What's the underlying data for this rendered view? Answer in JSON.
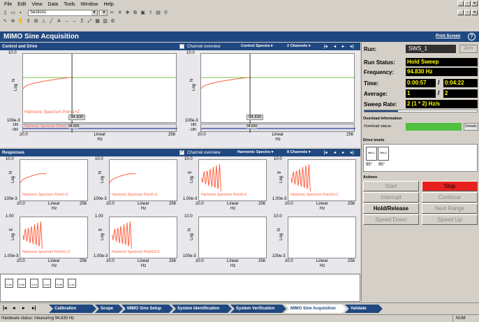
{
  "menu": {
    "items": [
      "File",
      "Edit",
      "View",
      "Data",
      "Tools",
      "Window",
      "Help"
    ]
  },
  "toolbar": {
    "section_select": "Section1"
  },
  "app": {
    "title": "MIMO Sine Acquisition",
    "print_screen": "Print Screen",
    "help": "?"
  },
  "control_panel": {
    "title": "Control and Drive",
    "channel_overview": "Channel overview",
    "control_spectra": "Control Spectra",
    "channels": "2 Channels"
  },
  "responses_panel": {
    "title": "Responses",
    "channel_overview": "Channel overview",
    "harmonic_spectra": "Harmonic Spectra",
    "channels": "8 Channels"
  },
  "plots": {
    "top": [
      {
        "ymax": "10.0",
        "ymin": "100e-3",
        "ylab": "Log",
        "yunit": "N",
        "legend": "Harmonic Spectrum Point1+Z",
        "marker": "94.830",
        "xmin": "20.0",
        "xmax": "256",
        "xlab": "Linear",
        "xunit": "Hz",
        "sub_ymax": "180",
        "sub_ymin": "-180",
        "sub_unit": "°",
        "sub_legend": "Harmonic Spectrum Point1+Z",
        "sub_marker": "94.830"
      },
      {
        "ymax": "10.0",
        "ymin": "100e-3",
        "ylab": "Log",
        "yunit": "N",
        "legend": "",
        "marker": "94.830",
        "xmin": "20.0",
        "xmax": "256",
        "xlab": "Linear",
        "xunit": "Hz",
        "sub_ymax": "180",
        "sub_ymin": "-180",
        "sub_unit": "°",
        "sub_legend": "",
        "sub_marker": "94.830"
      }
    ],
    "responses": [
      {
        "ymax": "10.0",
        "ymin": "100e-3",
        "ylab": "Log",
        "yunit": "N",
        "legend": "Harmonic Spectrum Point1+Z",
        "xmin": "20.0",
        "xmax": "256",
        "xlab": "Linear",
        "xunit": "Hz"
      },
      {
        "ymax": "10.0",
        "ymin": "100e-3",
        "ylab": "Log",
        "yunit": "N",
        "legend": "Harmonic Spectrum Point2+Z",
        "xmin": "20.0",
        "xmax": "256",
        "xlab": "Linear",
        "xunit": "Hz"
      },
      {
        "ymax": "10.0",
        "ymin": "1.00e-3",
        "ylab": "Log",
        "yunit": "g",
        "legend": "Harmonic Spectrum Point3+Z",
        "xmin": "20.0",
        "xmax": "256",
        "xlab": "Linear",
        "xunit": "Hz"
      },
      {
        "ymax": "10.0",
        "ymin": "1.00e-3",
        "ylab": "Log",
        "yunit": "g",
        "legend": "Harmonic Spectrum Point10+Z",
        "xmin": "20.0",
        "xmax": "256",
        "xlab": "Linear",
        "xunit": "Hz"
      },
      {
        "ymax": "1.00",
        "ymin": "1.00e-3",
        "ylab": "Log",
        "yunit": "g",
        "legend": "Harmonic Spectrum Point11+Z",
        "xmin": "20.0",
        "xmax": "256",
        "xlab": "Linear",
        "xunit": "Hz"
      },
      {
        "ymax": "1.00",
        "ymin": "1.00e-3",
        "ylab": "Log",
        "yunit": "g",
        "legend": "Harmonic Spectrum Point12+Z",
        "xmin": "20.0",
        "xmax": "256",
        "xlab": "Linear",
        "xunit": "Hz"
      },
      {
        "ymax": "10.0",
        "ymin": "100e-3",
        "ylab": "Log",
        "yunit": "N",
        "legend": "",
        "xmin": "20.0",
        "xmax": "256",
        "xlab": "Linear",
        "xunit": "Hz"
      },
      {
        "ymax": "10.0",
        "ymin": "100e-3",
        "ylab": "Log",
        "yunit": "N",
        "legend": "",
        "xmin": "20.0",
        "xmax": "256",
        "xlab": "Linear",
        "xunit": "Hz"
      }
    ]
  },
  "chart_data": {
    "type": "line",
    "x_range": [
      20,
      256
    ],
    "cursor_x": 94.83,
    "color": "#ff6040",
    "reference_color": "#70c040"
  },
  "channels_strip": [
    "2.00",
    "2.00",
    "0.10",
    "0.10",
    "0.05",
    "0.10"
  ],
  "run": {
    "label": "Run:",
    "name": "SWS_1",
    "arm": "Arm",
    "status_label": "Run Status:",
    "status": "Hold Sweep",
    "freq_label": "Frequency:",
    "freq": "94.830 Hz",
    "time_label": "Time:",
    "time_elapsed": "0:00:57",
    "time_total": "0:04:22",
    "avg_label": "Average:",
    "avg": "1",
    "avg_total": "2",
    "rate_label": "Sweep Rate:",
    "rate": "2 (1 * 2) Hz/s",
    "progress": 0.3
  },
  "overload": {
    "title": "Overload Information",
    "label": "Overload status:",
    "details": "Details",
    "color": "#50c040"
  },
  "drive": {
    "title": "Drive levels",
    "ch1": "Mfa:1",
    "ch2": "Mfa:2",
    "val1": "95°",
    "val2": "95°"
  },
  "actions": {
    "title": "Actions",
    "start": "Start",
    "stop": "Stop",
    "interrupt": "Interrupt",
    "continue": "Continue",
    "hold": "Hold/Release",
    "next": "Next Range",
    "down": "Speed Down",
    "up": "Speed Up"
  },
  "nav": {
    "crumbs": [
      "Calibration",
      "Scope",
      "MIMO Sine Setup",
      "System Identification",
      "System Verification",
      "MIMO Sine Acquisition",
      "Validate"
    ],
    "active": "MIMO Sine Acquisition"
  },
  "status": {
    "text": "Hardware status: measuring 94.830 Hz",
    "num": "NUM"
  }
}
